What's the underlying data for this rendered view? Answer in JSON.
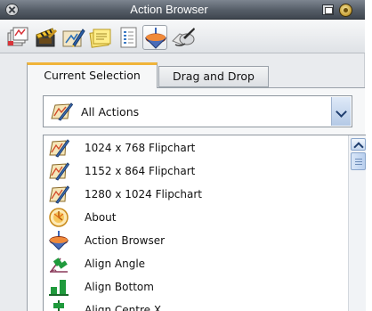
{
  "window": {
    "title": "Action Browser"
  },
  "toolbar": {
    "icons": [
      "flipchart-pages-icon",
      "film-clapper-icon",
      "pen-drawing-icon",
      "sticky-notes-icon",
      "document-list-icon",
      "action-spinner-icon",
      "eraser-pen-icon"
    ],
    "active_icon": "action-spinner-icon"
  },
  "tabs": {
    "current_selection": "Current Selection",
    "drag_and_drop": "Drag and Drop",
    "active": "Current Selection"
  },
  "filter": {
    "selected": "All Actions"
  },
  "list": {
    "items": [
      {
        "label": "1024 x 768 Flipchart",
        "icon": "flipchart-icon"
      },
      {
        "label": "1152 x 864 Flipchart",
        "icon": "flipchart-icon"
      },
      {
        "label": "1280 x 1024 Flipchart",
        "icon": "flipchart-icon"
      },
      {
        "label": "About",
        "icon": "about-icon"
      },
      {
        "label": "Action Browser",
        "icon": "action-browser-icon"
      },
      {
        "label": "Align Angle",
        "icon": "align-angle-icon"
      },
      {
        "label": "Align Bottom",
        "icon": "align-bottom-icon"
      },
      {
        "label": "Align Centre X",
        "icon": "align-centre-x-icon"
      }
    ]
  },
  "colors": {
    "title_bar": "#555d67",
    "active_tab_accent": "#f0b43a",
    "align_icon_green": "#1f9a3c"
  }
}
